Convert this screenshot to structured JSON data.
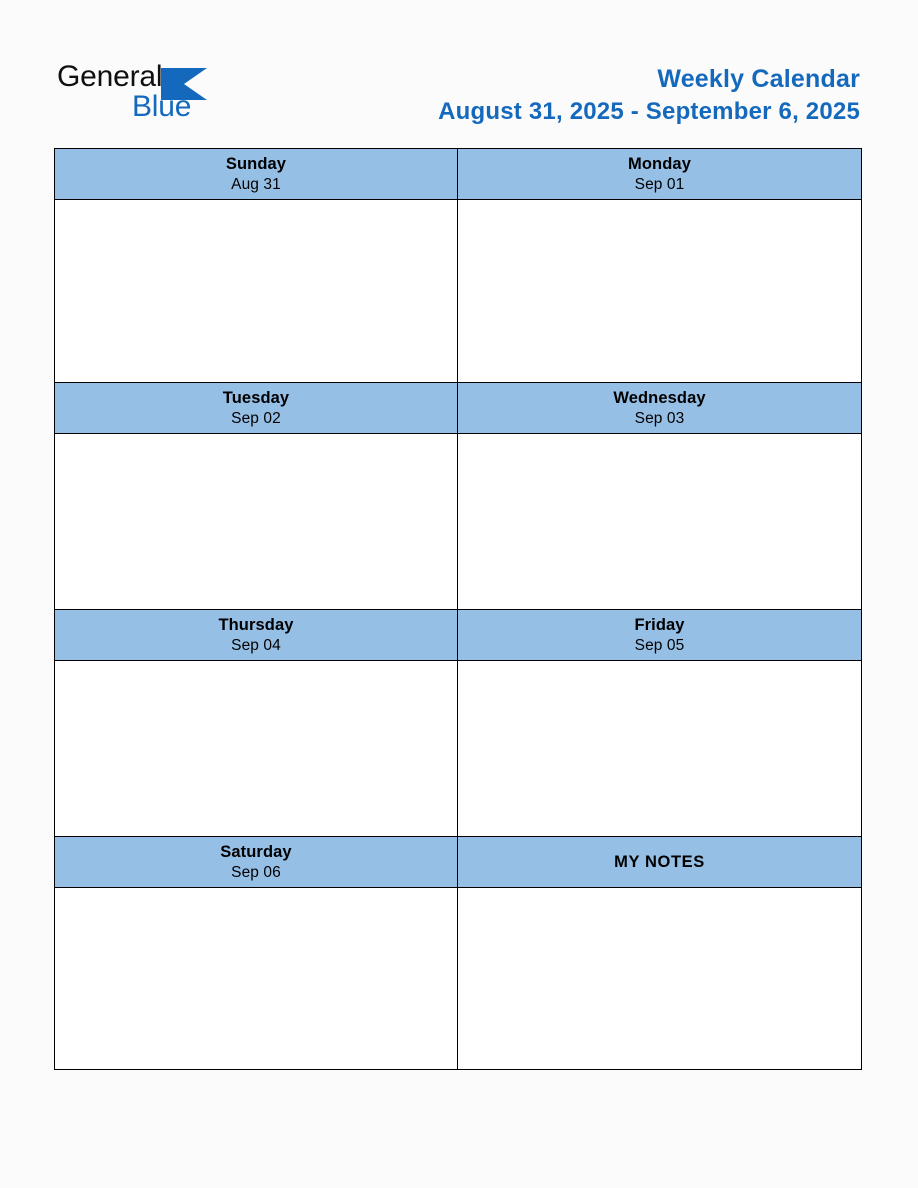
{
  "brand": {
    "name_primary": "General",
    "name_secondary": "Blue",
    "triangle_icon": "triangle-icon",
    "primary_color": "#101010",
    "secondary_color": "#1569bd"
  },
  "header": {
    "title": "Weekly Calendar",
    "date_range": "August 31, 2025 - September 6, 2025",
    "title_color": "#1569bd"
  },
  "calendar": {
    "header_background": "#96bfe6",
    "body_background": "#ffffff",
    "border_color": "#000000",
    "rows": [
      {
        "left": {
          "name": "Sunday",
          "date": "Aug 31"
        },
        "right": {
          "name": "Monday",
          "date": "Sep 01"
        }
      },
      {
        "left": {
          "name": "Tuesday",
          "date": "Sep 02"
        },
        "right": {
          "name": "Wednesday",
          "date": "Sep 03"
        }
      },
      {
        "left": {
          "name": "Thursday",
          "date": "Sep 04"
        },
        "right": {
          "name": "Friday",
          "date": "Sep 05"
        }
      },
      {
        "left": {
          "name": "Saturday",
          "date": "Sep 06"
        },
        "right": {
          "name": "MY NOTES",
          "date": ""
        }
      }
    ]
  }
}
